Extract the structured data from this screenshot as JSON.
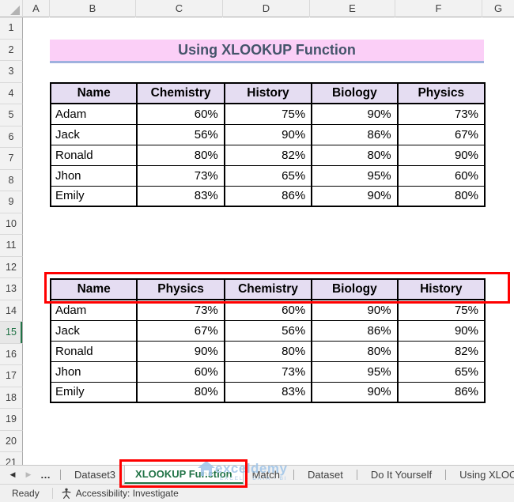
{
  "banner": {
    "title": "Using XLOOKUP Function"
  },
  "grid": {
    "column_letters": [
      "A",
      "B",
      "C",
      "D",
      "E",
      "F",
      "G"
    ],
    "row_numbers": [
      "1",
      "2",
      "3",
      "4",
      "5",
      "6",
      "7",
      "8",
      "9",
      "10",
      "11",
      "12",
      "13",
      "14",
      "15",
      "16",
      "17",
      "18",
      "19",
      "20",
      "21"
    ],
    "active_row": "15"
  },
  "tables": {
    "original": {
      "headers": [
        "Name",
        "Chemistry",
        "History",
        "Biology",
        "Physics"
      ],
      "rows": [
        [
          "Adam",
          "60%",
          "75%",
          "90%",
          "73%"
        ],
        [
          "Jack",
          "56%",
          "90%",
          "86%",
          "67%"
        ],
        [
          "Ronald",
          "80%",
          "82%",
          "80%",
          "90%"
        ],
        [
          "Jhon",
          "73%",
          "65%",
          "95%",
          "60%"
        ],
        [
          "Emily",
          "83%",
          "86%",
          "90%",
          "80%"
        ]
      ]
    },
    "rearranged": {
      "headers": [
        "Name",
        "Physics",
        "Chemistry",
        "Biology",
        "History"
      ],
      "rows": [
        [
          "Adam",
          "73%",
          "60%",
          "90%",
          "75%"
        ],
        [
          "Jack",
          "67%",
          "56%",
          "86%",
          "90%"
        ],
        [
          "Ronald",
          "90%",
          "80%",
          "80%",
          "82%"
        ],
        [
          "Jhon",
          "60%",
          "73%",
          "95%",
          "65%"
        ],
        [
          "Emily",
          "80%",
          "83%",
          "90%",
          "86%"
        ]
      ]
    }
  },
  "sheet_tabs": {
    "more_label": "…",
    "items": [
      {
        "label": "Dataset3",
        "active": false
      },
      {
        "label": "XLOOKUP Function",
        "active": true
      },
      {
        "label": "Match",
        "active": false
      },
      {
        "label": "Dataset",
        "active": false
      },
      {
        "label": "Do It Yourself",
        "active": false
      },
      {
        "label": "Using XLOOK",
        "active": false
      }
    ]
  },
  "status_bar": {
    "mode": "Ready",
    "accessibility": "Accessibility: Investigate"
  },
  "watermark": {
    "name": "exceldemy",
    "tagline": "EXCEL - DATA - BI"
  },
  "colors": {
    "banner_pink": "#FBCFF7",
    "banner_underline": "#9FB1DE",
    "header_lavender": "#E5DDF2",
    "highlight_red": "#FF0000",
    "excel_green": "#217346",
    "title_text": "#44546A"
  }
}
